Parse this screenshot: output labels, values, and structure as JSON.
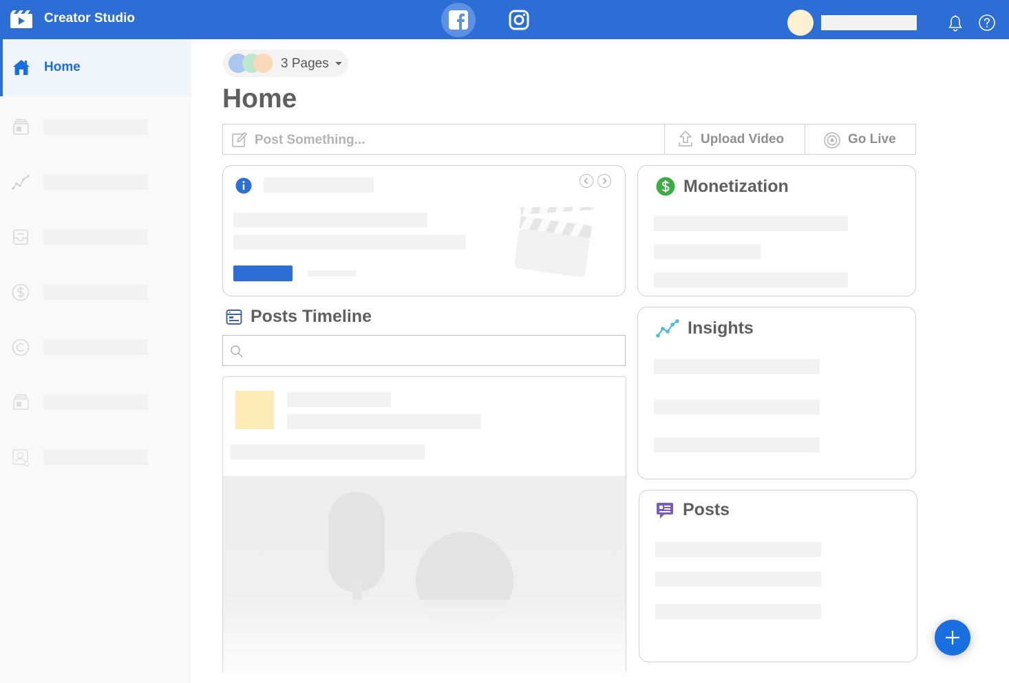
{
  "app": {
    "title": "Creator Studio"
  },
  "header": {
    "platforms": [
      {
        "name": "Facebook",
        "icon": "facebook-icon",
        "active": true
      },
      {
        "name": "Instagram",
        "icon": "instagram-icon",
        "active": false
      }
    ],
    "notifications_icon": "bell-icon",
    "help_icon": "help-icon"
  },
  "sidebar": {
    "items": [
      {
        "label": "Home",
        "icon": "home-icon",
        "active": true
      },
      {
        "label": "",
        "icon": "content-library-icon"
      },
      {
        "label": "",
        "icon": "insights-icon"
      },
      {
        "label": "",
        "icon": "inbox-icon"
      },
      {
        "label": "",
        "icon": "monetization-icon"
      },
      {
        "label": "",
        "icon": "copyright-icon"
      },
      {
        "label": "",
        "icon": "creative-tools-icon"
      },
      {
        "label": "",
        "icon": "page-roles-icon"
      }
    ]
  },
  "page_selector": {
    "label": "3 Pages"
  },
  "main": {
    "title": "Home",
    "composer": {
      "post_placeholder": "Post Something...",
      "upload_label": "Upload Video",
      "live_label": "Go Live"
    },
    "timeline": {
      "title": "Posts Timeline"
    },
    "cards": {
      "monetization": {
        "title": "Monetization"
      },
      "insights": {
        "title": "Insights"
      },
      "posts": {
        "title": "Posts"
      }
    }
  },
  "colors": {
    "brand_blue": "#2c6ed6",
    "monetization_green": "#3bab44",
    "insights_teal": "#4dbbdc",
    "posts_purple": "#7a5ac4"
  }
}
